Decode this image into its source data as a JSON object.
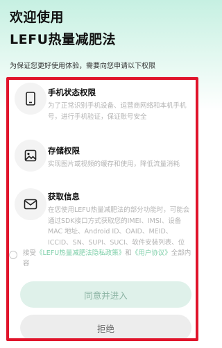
{
  "header": {
    "title_line1": "欢迎使用",
    "title_line2": "LEFU热量减肥法",
    "subtitle": "为保证您更好使用体验，需要向您申请以下权限"
  },
  "permissions": [
    {
      "icon": "phone-icon",
      "title": "手机状态权限",
      "desc": "为了正常识别手机设备、运营商网络和本机手机号，进行手机验证，保证账号安全"
    },
    {
      "icon": "image-icon",
      "title": "存储权限",
      "desc": "实现图片或视频的缓存和使用，降低流量消耗"
    },
    {
      "icon": "mail-icon",
      "title": "获取信息",
      "desc": "在您使用LEFU热量减肥法的部分功能时，可能会通过SDK接口方式获取您的IMEI、IMSI、设备MAC 地址、Android ID、OAID、MEID、ICCID、SN、SUPI、SUCI、软件安装列表、位置、BSSID"
    }
  ],
  "agreement": {
    "prefix": "接受",
    "privacy_link": "《LEFU热量减肥法隐私政策》",
    "and": "和",
    "user_link": "《用户协议》",
    "suffix": "全部内容"
  },
  "buttons": {
    "agree": "同意并进入",
    "reject": "拒绝"
  },
  "colors": {
    "frame": "#e0142b",
    "link": "#7ecfa9",
    "agree_button_bg": "#dff1ea",
    "reject_button_bg": "#ededed"
  }
}
